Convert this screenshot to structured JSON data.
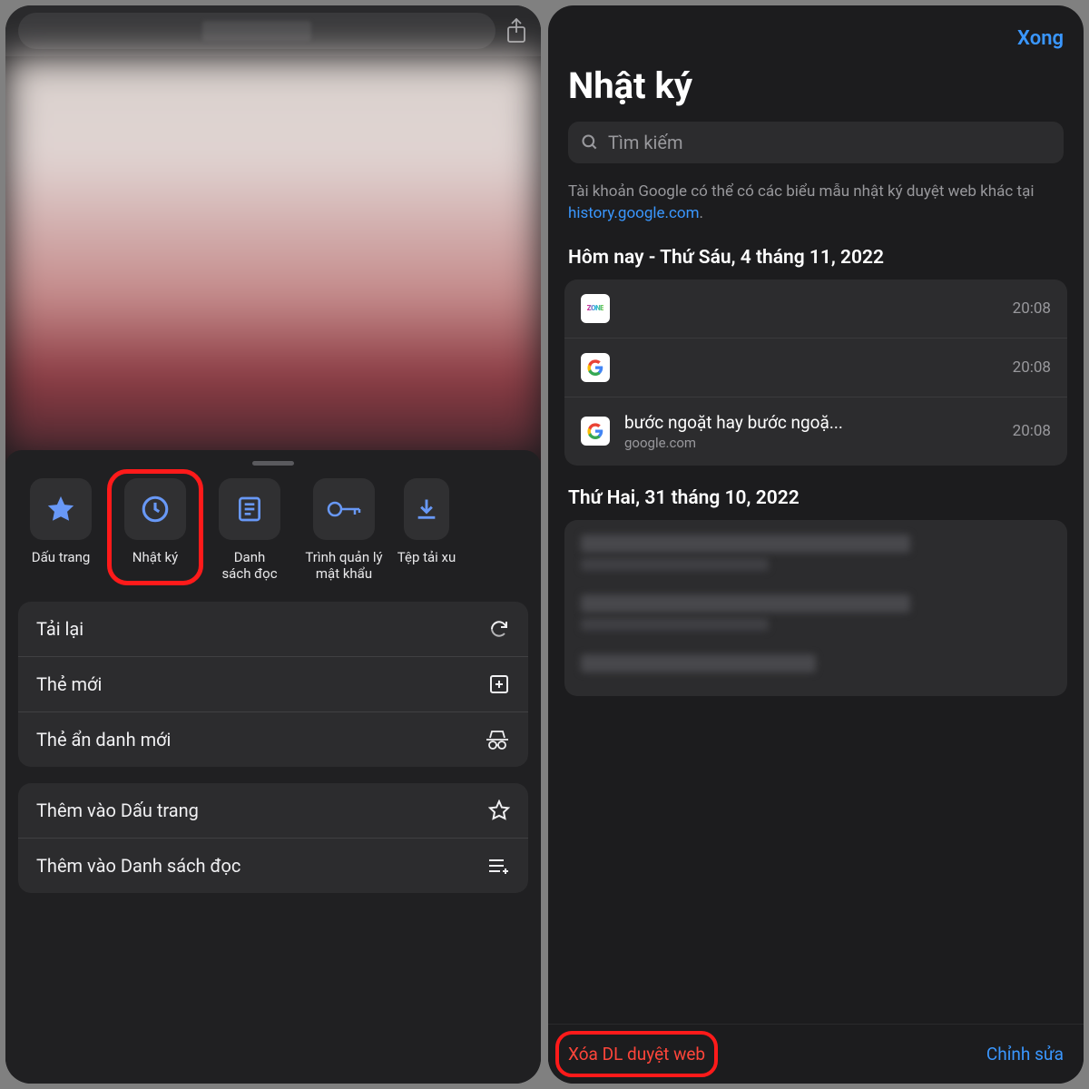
{
  "left": {
    "tiles": [
      {
        "label": "Dấu trang"
      },
      {
        "label": "Nhật ký"
      },
      {
        "label": "Danh\nsách đọc"
      },
      {
        "label": "Trình quản lý\nmật khẩu"
      },
      {
        "label": "Tệp\ntải xu"
      }
    ],
    "menu1": [
      {
        "label": "Tải lại"
      },
      {
        "label": "Thẻ mới"
      },
      {
        "label": "Thẻ ẩn danh mới"
      }
    ],
    "menu2": [
      {
        "label": "Thêm vào Dấu trang"
      },
      {
        "label": "Thêm vào Danh sách đọc"
      }
    ]
  },
  "right": {
    "done": "Xong",
    "title": "Nhật ký",
    "search_placeholder": "Tìm kiếm",
    "info_prefix": "Tài khoản Google có thể có các biểu mẫu nhật ký duyệt web khác tại ",
    "info_link": "history.google.com",
    "info_suffix": ".",
    "sections": [
      {
        "header": "Hôm nay - Thứ Sáu, 4 tháng 11, 2022",
        "rows": [
          {
            "icon": "zone",
            "title": "",
            "sub": "",
            "time": "20:08"
          },
          {
            "icon": "google",
            "title": "",
            "sub": "",
            "time": "20:08"
          },
          {
            "icon": "google",
            "title": "bước ngoặt hay bước ngoặ...",
            "sub": "google.com",
            "time": "20:08"
          }
        ]
      },
      {
        "header": "Thứ Hai, 31 tháng 10, 2022"
      }
    ],
    "clear": "Xóa DL duyệt web",
    "edit": "Chỉnh sửa"
  }
}
